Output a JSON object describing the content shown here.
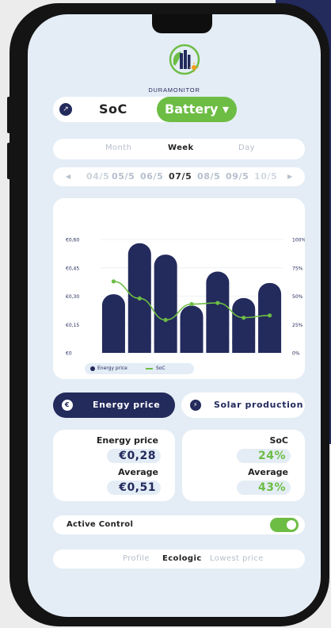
{
  "brand": {
    "name": "DURAMONITOR"
  },
  "view_toggle": {
    "left_label": "SoC",
    "right_label": "Battery ▾"
  },
  "period_tabs": [
    "Month",
    "Week",
    "Day"
  ],
  "period_selected": "Week",
  "dates": [
    "04/5",
    "05/5",
    "06/5",
    "07/5",
    "08/5",
    "09/5",
    "10/5"
  ],
  "date_selected": "07/5",
  "chart_data": {
    "type": "bar",
    "categories": [
      "04/5",
      "05/5",
      "06/5",
      "07/5",
      "08/5",
      "09/5",
      "10/5"
    ],
    "series": [
      {
        "name": "Energy price",
        "type": "bar",
        "axis": "left",
        "values": [
          0.31,
          0.58,
          0.52,
          0.25,
          0.43,
          0.29,
          0.37
        ]
      },
      {
        "name": "SoC",
        "type": "line",
        "axis": "right",
        "values": [
          63,
          48,
          29,
          43,
          44,
          31,
          33
        ]
      }
    ],
    "y_left": {
      "ticks": [
        "€0,60",
        "€0,45",
        "€0,30",
        "€0,15",
        "€0"
      ],
      "ylim": [
        0,
        0.6
      ]
    },
    "y_right": {
      "ticks": [
        "100%",
        "75%",
        "50%",
        "25%",
        "0%"
      ],
      "ylim": [
        0,
        100
      ]
    },
    "colors": {
      "bar": "#232a5c",
      "line": "#6dbd45"
    },
    "grid": true,
    "legend": "bottom-left"
  },
  "legend": {
    "energy": "Energy price",
    "soc": "SoC"
  },
  "mode_buttons": {
    "energy": "Energy price",
    "solar": "Solar production"
  },
  "stats_left": {
    "label1": "Energy price",
    "value1": "€0,28",
    "label2": "Average",
    "value2": "€0,51"
  },
  "stats_right": {
    "label1": "SoC",
    "value1": "24%",
    "label2": "Average",
    "value2": "43%"
  },
  "active_control": {
    "label": "Active Control",
    "enabled": true
  },
  "strategy_tabs": [
    "Profile",
    "Ecologic",
    "Lowest price"
  ],
  "strategy_selected": "Ecologic",
  "colors": {
    "navy": "#232a5c",
    "green": "#6dbd45",
    "background": "#e4edf6"
  }
}
